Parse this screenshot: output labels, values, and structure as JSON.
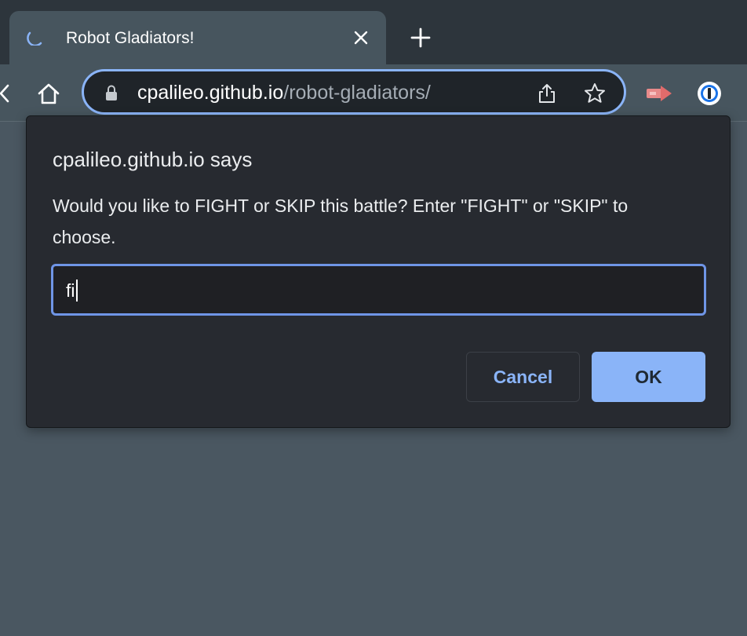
{
  "browser": {
    "tab": {
      "title": "Robot Gladiators!",
      "icon": "loading-spinner-icon"
    },
    "new_tab_icon": "plus-icon",
    "address": {
      "host": "cpalileo.github.io",
      "path": "/robot-gladiators/"
    },
    "accent_color": "#8ab4f8"
  },
  "dialog": {
    "title": "cpalileo.github.io says",
    "message": "Would you like to FIGHT or SKIP this battle? Enter \"FIGHT\" or \"SKIP\" to choose.",
    "input_value": "fi",
    "cancel_label": "Cancel",
    "ok_label": "OK"
  }
}
